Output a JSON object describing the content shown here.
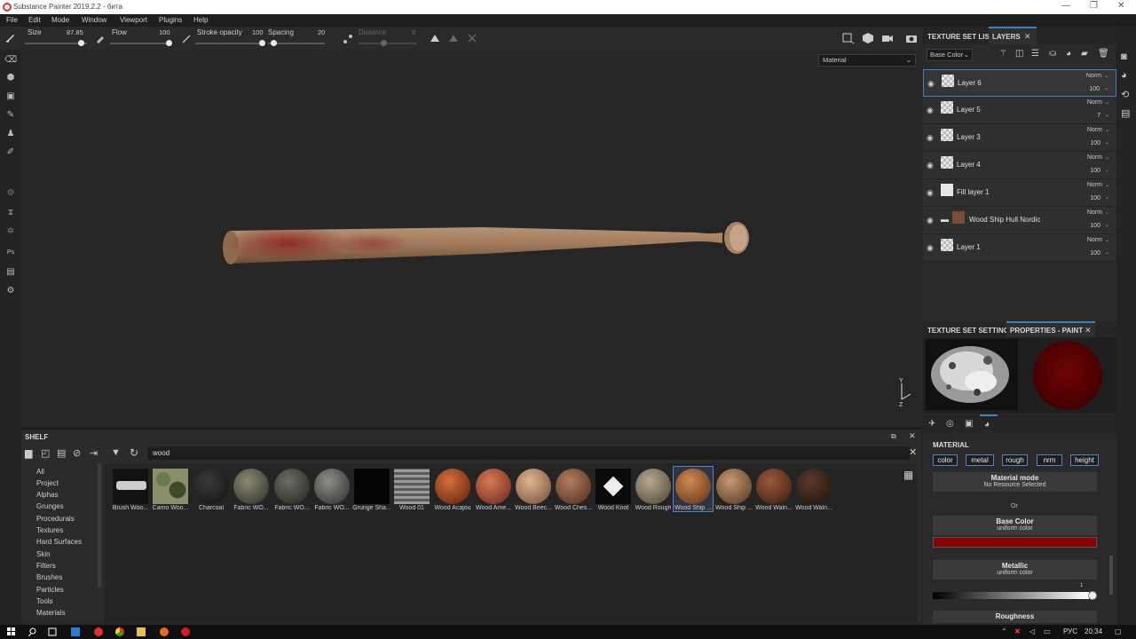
{
  "window": {
    "title": "Substance Painter 2019.2.2 - бита",
    "min": "—",
    "restore": "❐",
    "close": "✕"
  },
  "menu": [
    "File",
    "Edit",
    "Mode",
    "Window",
    "Viewport",
    "Plugins",
    "Help"
  ],
  "tool_options": {
    "size_label": "Size",
    "size_value": "87.85",
    "flow_label": "Flow",
    "flow_value": "100",
    "stroke_opacity_label": "Stroke opacity",
    "stroke_opacity_value": "100",
    "spacing_label": "Spacing",
    "spacing_value": "20",
    "distance_label": "Distance",
    "distance_value": "8"
  },
  "viewport": {
    "material_select": "Material",
    "axis_y": "Y",
    "axis_z": "Z"
  },
  "layers_panel": {
    "tab_texture_set_list": "TEXTURE SET LIST",
    "tab_layers": "LAYERS",
    "channel_select": "Base Color",
    "layers": [
      {
        "name": "Layer 6",
        "blend": "Norm",
        "opacity": "100",
        "selected": true
      },
      {
        "name": "Layer 5",
        "blend": "Norm",
        "opacity": "7",
        "selected": false
      },
      {
        "name": "Layer 3",
        "blend": "Norm",
        "opacity": "100",
        "selected": false
      },
      {
        "name": "Layer 4",
        "blend": "Norm",
        "opacity": "100",
        "selected": false
      },
      {
        "name": "Fill layer 1",
        "blend": "Norm",
        "opacity": "100",
        "selected": false
      },
      {
        "name": "Wood Ship Hull Nordic",
        "blend": "Norm",
        "opacity": "100",
        "selected": false
      },
      {
        "name": "Layer 1",
        "blend": "Norm",
        "opacity": "100",
        "selected": false
      }
    ]
  },
  "properties_panel": {
    "tab_texture_set_settings": "TEXTURE SET SETTINGS",
    "tab_properties": "PROPERTIES - PAINT",
    "material_heading": "MATERIAL",
    "channels": [
      "color",
      "metal",
      "rough",
      "nrm",
      "height"
    ],
    "material_mode_title": "Material mode",
    "material_mode_sub": "No Resource Selected",
    "or": "Or",
    "base_color_title": "Base Color",
    "base_color_sub": "uniform color",
    "base_color_hex": "#8b0000",
    "metallic_title": "Metallic",
    "metallic_sub": "uniform color",
    "metallic_value": "1",
    "roughness_title": "Roughness"
  },
  "shelf": {
    "title": "SHELF",
    "search": "wood",
    "categories": [
      "All",
      "Project",
      "Alphas",
      "Grunges",
      "Procedurals",
      "Textures",
      "Hard Surfaces",
      "Skin",
      "Filters",
      "Brushes",
      "Particles",
      "Tools",
      "Materials"
    ],
    "items": [
      {
        "label": "Brush Woo...",
        "kind": "brush"
      },
      {
        "label": "Camo Woo...",
        "kind": "camo"
      },
      {
        "label": "Charcoal",
        "kind": "charcoal"
      },
      {
        "label": "Fabric WO...",
        "kind": "fabric"
      },
      {
        "label": "Fabric WO...",
        "kind": "fabric2"
      },
      {
        "label": "Fabric WO...",
        "kind": "fabric3"
      },
      {
        "label": "Grunge Sha...",
        "kind": "grunge"
      },
      {
        "label": "Wood 01",
        "kind": "wood01"
      },
      {
        "label": "Wood Acajou",
        "kind": "acajou"
      },
      {
        "label": "Wood Ame...",
        "kind": "ame"
      },
      {
        "label": "Wood Beec...",
        "kind": "beech"
      },
      {
        "label": "Wood Ches...",
        "kind": "chest"
      },
      {
        "label": "Wood Knot",
        "kind": "knot"
      },
      {
        "label": "Wood Rough",
        "kind": "rough"
      },
      {
        "label": "Wood Ship ...",
        "kind": "ship"
      },
      {
        "label": "Wood Ship ...",
        "kind": "ship2"
      },
      {
        "label": "Wood Waln...",
        "kind": "walnut"
      },
      {
        "label": "Wood Waln...",
        "kind": "walnut2"
      }
    ]
  },
  "taskbar": {
    "lang": "РУС",
    "time": "20:34"
  }
}
